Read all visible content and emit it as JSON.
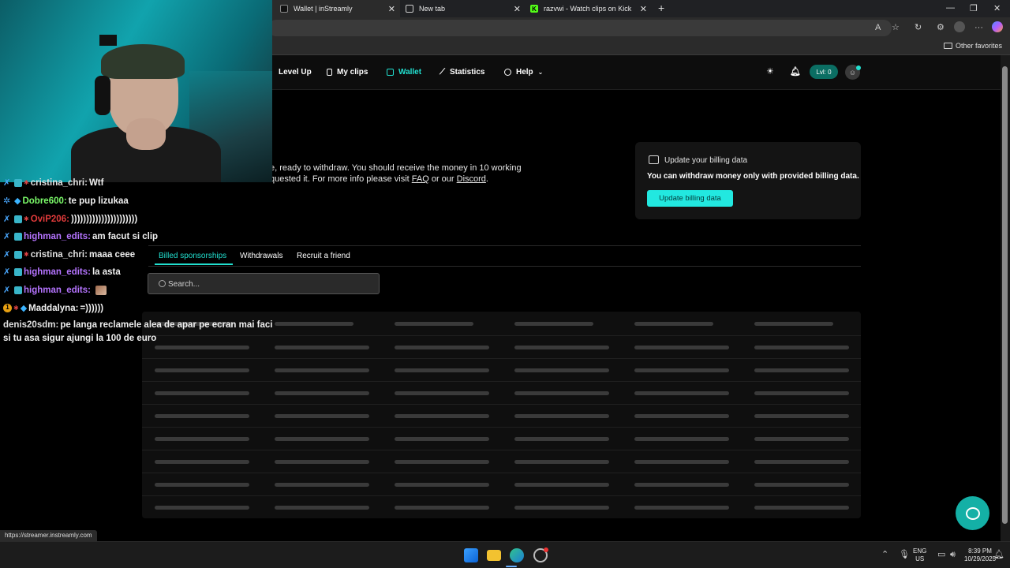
{
  "browser": {
    "tabs": [
      {
        "label": "Wallet | inStreamly",
        "active": true
      },
      {
        "label": "New tab",
        "active": false
      },
      {
        "label": "razvwi - Watch clips on Kick",
        "active": false
      }
    ],
    "new_tab_label": "+",
    "other_favorites": "Other favorites",
    "status_url": "https://streamer.instreamly.com"
  },
  "nav": {
    "items": [
      {
        "label": "Level Up",
        "icon": "level-up-icon"
      },
      {
        "label": "My clips",
        "icon": "clips-icon"
      },
      {
        "label": "Wallet",
        "icon": "wallet-icon",
        "active": true
      },
      {
        "label": "Statistics",
        "icon": "chart-icon"
      },
      {
        "label": "Help",
        "icon": "help-icon"
      }
    ],
    "level_badge": "Lvl: 0"
  },
  "wallet": {
    "info_line1": "e, ready to withdraw. You should receive the money in 10 working",
    "info_line2_pre": "quested it. For more info please visit ",
    "faq_link": "FAQ",
    "info_or": " or our ",
    "discord_link": "Discord",
    "info_end": "."
  },
  "billing": {
    "title": "Update your billing data",
    "description": "You can withdraw money only with provided billing data.",
    "button": "Update billing data"
  },
  "page_tabs": [
    {
      "label": "Billed sponsorships",
      "active": true
    },
    {
      "label": "Withdrawals",
      "active": false
    },
    {
      "label": "Recruit a friend",
      "active": false
    }
  ],
  "search": {
    "placeholder": "Search..."
  },
  "chat": [
    {
      "user": "cristina_chri",
      "text": "Wtf",
      "color": "#e0e0e0"
    },
    {
      "user": "Dobre600",
      "text": "te pup lizukaa",
      "color": "#7cfc6a"
    },
    {
      "user": "OviP206",
      "text": "))))))))))))))))))))))",
      "color": "#e23b3b"
    },
    {
      "user": "highman_edits",
      "text": "am facut si clip",
      "color": "#b574ff"
    },
    {
      "user": "cristina_chri",
      "text": "maaa ceee",
      "color": "#e0e0e0"
    },
    {
      "user": "highman_edits",
      "text": "la asta",
      "color": "#b574ff"
    },
    {
      "user": "highman_edits",
      "text": "",
      "color": "#b574ff"
    },
    {
      "user": "Maddalyna",
      "text": "=))))))",
      "color": "#f0f0f0"
    },
    {
      "user": "denis20sdm",
      "text": "pe langa reclamele alea de apar pe ecran mai faci",
      "color": "#e0e0e0"
    },
    {
      "user": "",
      "text": "si tu asa sigur ajungi la 100 de euro",
      "color": "#e0e0e0"
    }
  ],
  "taskbar": {
    "lang": "ENG",
    "region": "US",
    "time": "8:39 PM",
    "date": "10/29/2025"
  },
  "colors": {
    "accent": "#22e0d0",
    "button": "#22e8e0"
  }
}
